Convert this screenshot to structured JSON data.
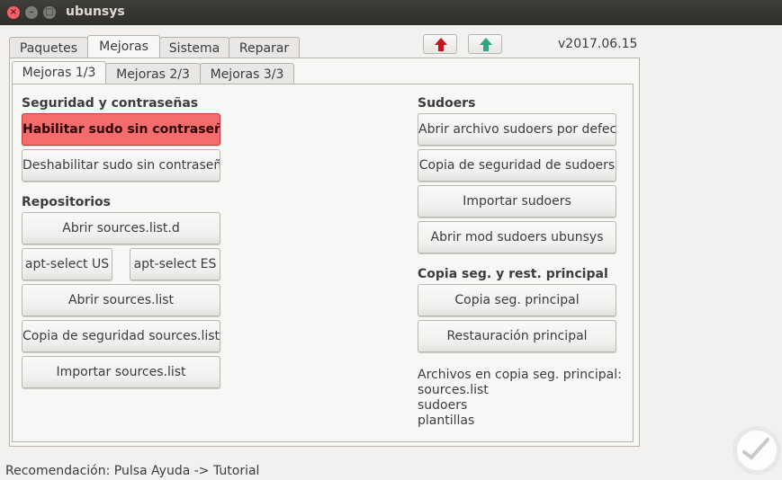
{
  "window": {
    "title": "ubunsys",
    "close_glyph": "×",
    "min_glyph": "–",
    "max_glyph": "□"
  },
  "version": "v2017.06.15",
  "main_tabs": [
    {
      "label": "Paquetes"
    },
    {
      "label": "Mejoras"
    },
    {
      "label": "Sistema"
    },
    {
      "label": "Reparar"
    }
  ],
  "sub_tabs": [
    {
      "label": "Mejoras 1/3"
    },
    {
      "label": "Mejoras 2/3"
    },
    {
      "label": "Mejoras 3/3"
    }
  ],
  "left": {
    "security_title": "Seguridad y contraseñas",
    "enable_sudo": "Habilitar sudo sin contraseña",
    "disable_sudo": "Deshabilitar sudo sin contraseña",
    "repos_title": "Repositorios",
    "open_sources_d": "Abrir sources.list.d",
    "apt_us": "apt-select US",
    "apt_es": "apt-select ES",
    "open_sources": "Abrir sources.list",
    "backup_sources": "Copia de seguridad sources.list",
    "import_sources": "Importar sources.list"
  },
  "right": {
    "sudoers_title": "Sudoers",
    "open_default": "Abrir archivo sudoers por defecto",
    "backup_sudoers": "Copia de seguridad de sudoers",
    "import_sudoers": "Importar sudoers",
    "open_mod": "Abrir mod sudoers ubunsys",
    "main_backup_title": "Copia seg. y rest. principal",
    "main_backup": "Copia seg. principal",
    "main_restore": "Restauración principal",
    "files_label": "Archivos en copia seg. principal:",
    "files": [
      "sources.list",
      "sudoers",
      "plantillas"
    ]
  },
  "status": "Recomendación: Pulsa Ayuda -> Tutorial",
  "colors": {
    "accent_red": "#f66b6b",
    "arrow_up": "#2ea683",
    "arrow_down": "#c0161c"
  }
}
